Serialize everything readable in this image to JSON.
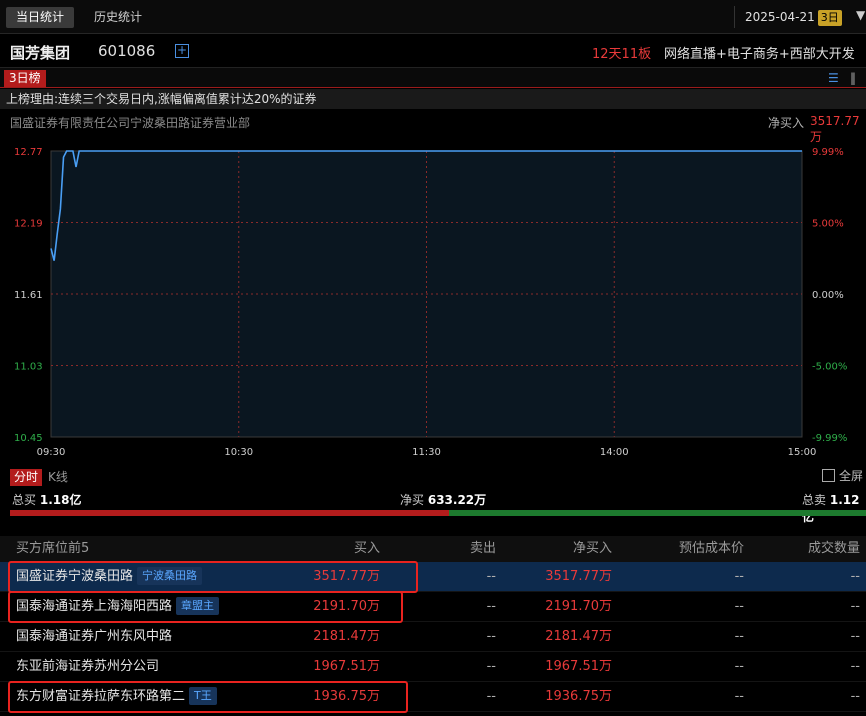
{
  "tabs": [
    {
      "label": "当日统计",
      "active": true
    },
    {
      "label": "历史统计",
      "active": false
    }
  ],
  "date": "2025-04-21",
  "date_badge": "3日",
  "stock": {
    "name": "国芳集团",
    "code": "601086",
    "streak": "12天11板",
    "concepts": "网络直播+电子商务+西部大开发"
  },
  "list_tag": "3日榜",
  "reason": "上榜理由:连续三个交易日内,涨幅偏离值累计达20%的证券",
  "seat": {
    "name": "国盛证券有限责任公司宁波桑田路证券营业部",
    "net_label": "净买入",
    "net_value": "3517.77万"
  },
  "chart_data": {
    "type": "line",
    "y_labels": [
      "12.77",
      "12.19",
      "11.61",
      "11.03",
      "10.45"
    ],
    "pct_labels": [
      "9.99%",
      "5.00%",
      "0.00%",
      "-5.00%",
      "-9.99%"
    ],
    "x_labels": [
      "09:30",
      "10:30",
      "11:30",
      "14:00",
      "15:00"
    ],
    "ylim": [
      10.45,
      12.77
    ],
    "grid": true,
    "series": [
      {
        "x": [
          "09:30",
          "09:31",
          "09:32",
          "09:33",
          "09:34",
          "09:35",
          "09:36",
          "09:37",
          "09:38",
          "09:39",
          "09:40",
          "09:41",
          "15:00"
        ],
        "values": [
          11.98,
          11.88,
          12.1,
          12.3,
          12.72,
          12.77,
          12.77,
          12.77,
          12.64,
          12.77,
          12.77,
          12.77,
          12.77
        ]
      }
    ],
    "line_color": "#4a9ff5"
  },
  "switch": {
    "intraday": "分时",
    "kline": "K线",
    "fullscreen": "全屏"
  },
  "totals": {
    "buy_label": "总买",
    "buy_value": "1.18亿",
    "net_label": "净买",
    "net_value": "633.22万",
    "sell_label": "总卖",
    "sell_value": "1.12亿",
    "buy_ratio": 0.513
  },
  "table": {
    "headers": [
      "买方席位前5",
      "买入",
      "卖出",
      "净买入",
      "预估成本价",
      "成交数量"
    ],
    "rows": [
      {
        "name": "国盛证券宁波桑田路",
        "tag": "宁波桑田路",
        "buy": "3517.77万",
        "sell": "--",
        "net": "3517.77万",
        "cost": "--",
        "vol": "--",
        "selected": true,
        "highlight": true
      },
      {
        "name": "国泰海通证券上海海阳西路",
        "tag": "章盟主",
        "buy": "2191.70万",
        "sell": "--",
        "net": "2191.70万",
        "cost": "--",
        "vol": "--",
        "selected": false,
        "highlight": true
      },
      {
        "name": "国泰海通证券广州东风中路",
        "tag": "",
        "buy": "2181.47万",
        "sell": "--",
        "net": "2181.47万",
        "cost": "--",
        "vol": "--",
        "selected": false,
        "highlight": false
      },
      {
        "name": "东亚前海证券苏州分公司",
        "tag": "",
        "buy": "1967.51万",
        "sell": "--",
        "net": "1967.51万",
        "cost": "--",
        "vol": "--",
        "selected": false,
        "highlight": false
      },
      {
        "name": "东方财富证券拉萨东环路第二",
        "tag": "T王",
        "buy": "1936.75万",
        "sell": "--",
        "net": "1936.75万",
        "cost": "--",
        "vol": "--",
        "selected": false,
        "highlight": true
      }
    ]
  },
  "colors": {
    "up": "#e83a3a",
    "down": "#1d7a2e",
    "accent": "#4a9ff5",
    "highlight": "#e8231f"
  }
}
